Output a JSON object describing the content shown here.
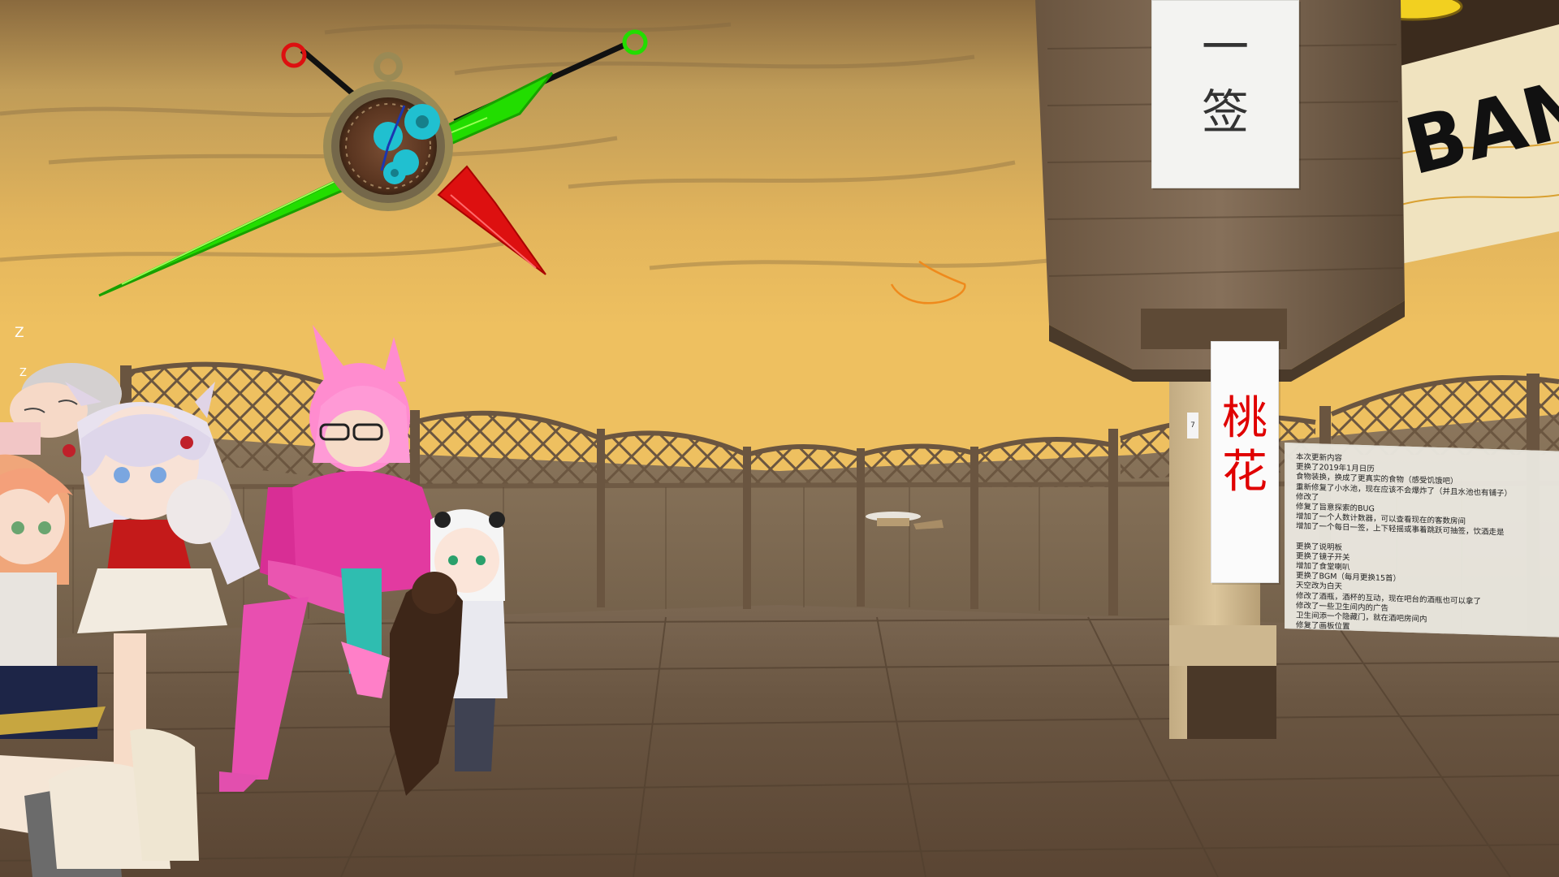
{
  "scene": {
    "signs": {
      "top_sign_chars": [
        "一",
        "签"
      ],
      "red_sign_chars": [
        "桃",
        "花"
      ],
      "red_sign_color": "#e00000",
      "small_pole_sign": "7"
    },
    "banner_text": "BAN",
    "sleep_indicator": [
      "Z",
      "Z"
    ],
    "clock_colors": {
      "green": "#22dd00",
      "red": "#dd1010",
      "cyan": "#20c0d0",
      "brass": "#9a8a55"
    },
    "sky_color": "#e8b85a",
    "floor_color": "#6e5a45"
  },
  "notice_board": {
    "lines": [
      "本次更新内容",
      "更换了2019年1月日历",
      "食物装换，换成了更真实的食物（感受饥饿吧）",
      "重新修复了小水池，现在应该不会爆炸了（并且水池也有铺子）",
      "修改了",
      "修复了旨意探索的BUG",
      "增加了一个人数计数器，可以查看现在的客数房间",
      "增加了一个每日一签，上下轻摇或事着跳跃可抽签，饮酒走是",
      "",
      "更换了说明板",
      "更换了镜子开关",
      "增加了食堂喇叭",
      "更换了BGM（每月更换15首）",
      "天空改为白天",
      "修改了酒瓶，酒杯的互动，现在吧台的酒瓶也可以拿了",
      "修改了一些卫生间内的广告",
      "卫生间添一个隐藏门，就在酒吧房间内",
      "修复了画板位置"
    ]
  }
}
